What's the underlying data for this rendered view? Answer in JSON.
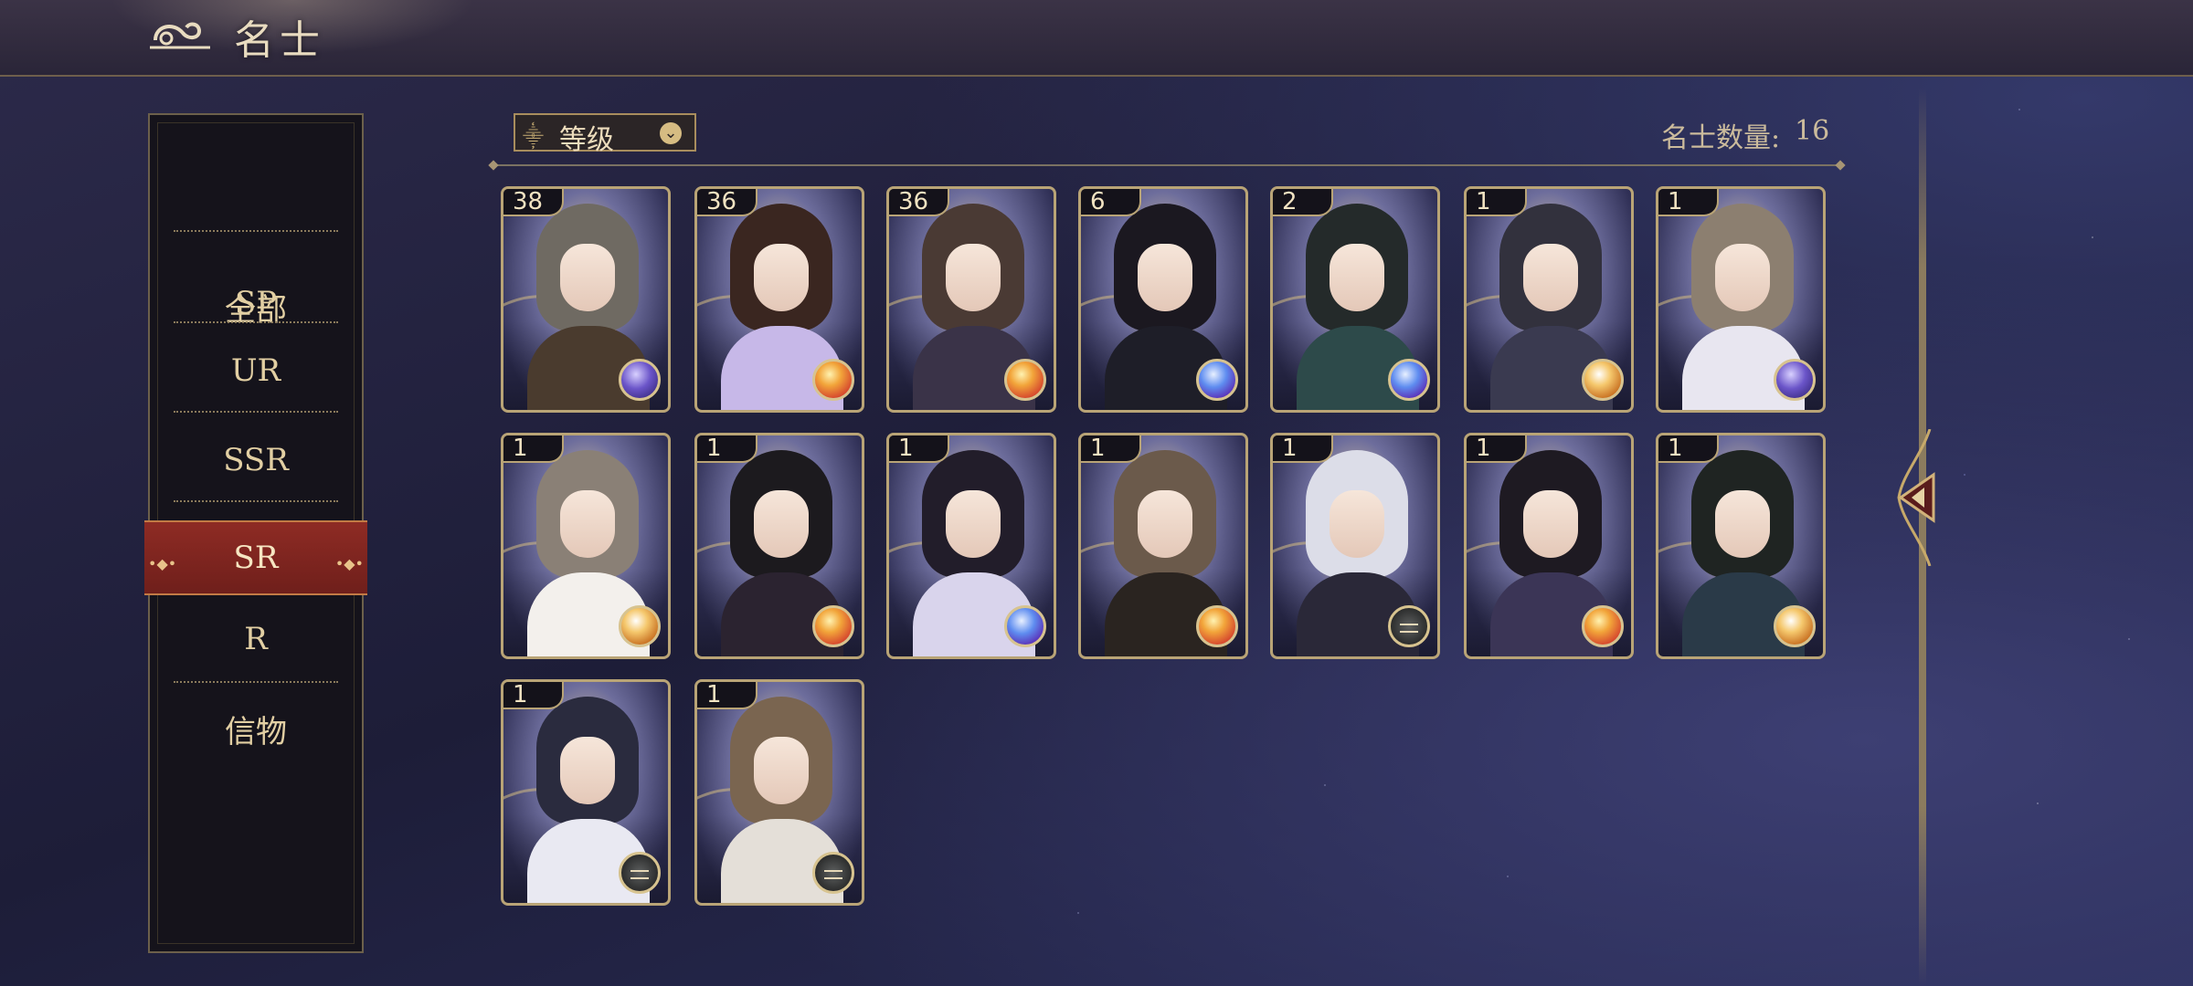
{
  "header": {
    "title": "名士"
  },
  "sidebar": {
    "items": [
      {
        "label": "全部",
        "active": false
      },
      {
        "label": "SP",
        "active": false
      },
      {
        "label": "UR",
        "active": false
      },
      {
        "label": "SSR",
        "active": false
      },
      {
        "label": "SR",
        "active": true
      },
      {
        "label": "R",
        "active": false
      },
      {
        "label": "信物",
        "active": false
      }
    ]
  },
  "toolbar": {
    "sort_label": "等级",
    "count_label": "名士数量:",
    "count_value": "16"
  },
  "cards": [
    {
      "level": "38",
      "orb": "purple",
      "hair": "#6f6a62",
      "body": "#4a3b2e"
    },
    {
      "level": "36",
      "orb": "red",
      "hair": "#3a2620",
      "body": "#c7b8e8"
    },
    {
      "level": "36",
      "orb": "red",
      "hair": "#4a3a34",
      "body": "#3a3348"
    },
    {
      "level": "6",
      "orb": "blue",
      "hair": "#1b1820",
      "body": "#1e1e28"
    },
    {
      "level": "2",
      "orb": "blue",
      "hair": "#242a2a",
      "body": "#2d4a4a"
    },
    {
      "level": "1",
      "orb": "orange",
      "hair": "#32313d",
      "body": "#3a3a50"
    },
    {
      "level": "1",
      "orb": "purple",
      "hair": "#8c7f70",
      "body": "#e8e6f0"
    },
    {
      "level": "1",
      "orb": "orange",
      "hair": "#8a8076",
      "body": "#f3f0ec"
    },
    {
      "level": "1",
      "orb": "red",
      "hair": "#1c1a1e",
      "body": "#2b2330"
    },
    {
      "level": "1",
      "orb": "blue",
      "hair": "#221d2a",
      "body": "#d9d4ec"
    },
    {
      "level": "1",
      "orb": "red",
      "hair": "#6b5a4b",
      "body": "#2a2420"
    },
    {
      "level": "1",
      "orb": "dark",
      "hair": "#dcdde8",
      "body": "#2a2838"
    },
    {
      "level": "1",
      "orb": "red",
      "hair": "#1e1a22",
      "body": "#3b3556"
    },
    {
      "level": "1",
      "orb": "orange",
      "hair": "#1f2422",
      "body": "#2a3a48"
    },
    {
      "level": "1",
      "orb": "dark",
      "hair": "#2a2b3e",
      "body": "#e9e9f2"
    },
    {
      "level": "1",
      "orb": "dark",
      "hair": "#7a6550",
      "body": "#e4dfd8"
    }
  ],
  "colors": {
    "accent_gold": "#d6bc82",
    "active_tab": "#8e2b24",
    "panel_bg": "#15131b"
  }
}
